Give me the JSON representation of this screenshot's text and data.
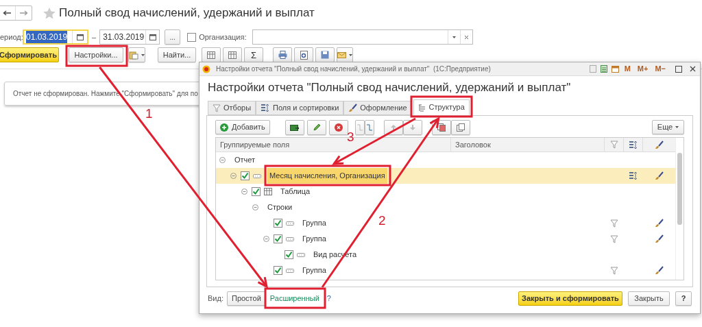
{
  "title": "Полный свод начислений, удержаний и выплат",
  "period": {
    "label": "ериод:",
    "from": "01.03.2019",
    "from_selected": true,
    "dash": "–",
    "to": "31.03.2019",
    "more": "..."
  },
  "organization": {
    "label": "Организация:",
    "checked": false
  },
  "toolbar": {
    "generate": "Сформировать",
    "settings": "Настройки...",
    "find": "Найти...",
    "sum": "Σ"
  },
  "message": "Отчет не сформирован. Нажмите \"Сформировать\" для по",
  "dialog": {
    "window_title": "Настройки отчета \"Полный свод начислений, удержаний и выплат\"  (1С:Предприятие)",
    "title_buttons": [
      "M",
      "M+",
      "M−"
    ],
    "heading": "Настройки отчета \"Полный свод начислений, удержаний и выплат\"",
    "tabs": [
      {
        "label": "Отборы",
        "kind": "filter",
        "selected": false
      },
      {
        "label": "Поля и сортировки",
        "kind": "fields",
        "selected": false
      },
      {
        "label": "Оформление",
        "kind": "brush",
        "selected": false
      },
      {
        "label": "Структура",
        "kind": "structure",
        "selected": true
      }
    ],
    "add": "Добавить",
    "more": "Еще",
    "columns": [
      "Группируемые поля",
      "Заголовок"
    ],
    "tree": [
      {
        "label": "Отчет",
        "expanded": true,
        "selected": false,
        "filter": false,
        "sort": false,
        "brush": false,
        "children": [
          {
            "label": "Месяц начисления, Организация",
            "kind": "group",
            "checked": true,
            "expanded": true,
            "selected": true,
            "filter": false,
            "sort": true,
            "brush": true,
            "children": [
              {
                "label": "Таблица",
                "kind": "table",
                "checked": true,
                "expanded": true,
                "selected": false,
                "filter": false,
                "sort": false,
                "brush": false,
                "children": [
                  {
                    "label": "Строки",
                    "expanded": true,
                    "selected": false,
                    "filter": false,
                    "sort": false,
                    "brush": false,
                    "children": [
                      {
                        "label": "Группа",
                        "kind": "group",
                        "checked": true,
                        "selected": false,
                        "filter": true,
                        "sort": false,
                        "brush": true
                      },
                      {
                        "label": "Группа",
                        "kind": "group",
                        "checked": true,
                        "expanded": true,
                        "selected": false,
                        "filter": true,
                        "sort": false,
                        "brush": true,
                        "children": [
                          {
                            "label": "Вид расчета",
                            "kind": "group",
                            "checked": true,
                            "selected": false,
                            "filter": false,
                            "sort": false,
                            "brush": false
                          }
                        ]
                      },
                      {
                        "label": "Группа",
                        "kind": "group",
                        "checked": true,
                        "selected": false,
                        "filter": true,
                        "sort": false,
                        "brush": true
                      }
                    ]
                  }
                ]
              }
            ]
          }
        ]
      }
    ],
    "view_label": "Вид:",
    "view_options": [
      {
        "label": "Простой",
        "selected": false
      },
      {
        "label": "Расширенный",
        "selected": true
      }
    ],
    "view_help": "?",
    "close_generate": "Закрыть и сформировать",
    "close": "Закрыть",
    "help": "?"
  },
  "annotations": [
    {
      "label": "1"
    },
    {
      "label": "2"
    },
    {
      "label": "3"
    }
  ]
}
